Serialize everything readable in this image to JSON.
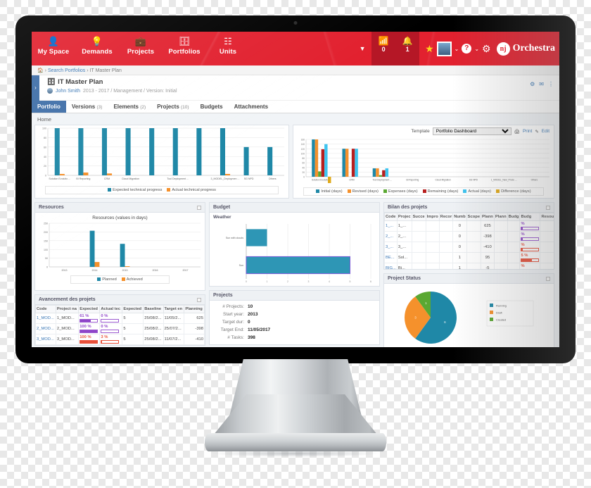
{
  "colors": {
    "brand_red": "#e2212f",
    "accent_blue": "#1f88a7",
    "orange": "#f5912c",
    "green": "#5aa832",
    "purple": "#8e44c8",
    "red": "#e8503a",
    "tab_blue": "#3f6fa8"
  },
  "topbar": {
    "nav": [
      {
        "label": "My Space",
        "icon": "user-icon"
      },
      {
        "label": "Demands",
        "icon": "lightbulb-icon"
      },
      {
        "label": "Projects",
        "icon": "briefcase-icon"
      },
      {
        "label": "Portfolios",
        "icon": "portfolio-icon"
      },
      {
        "label": "Units",
        "icon": "org-tree-icon"
      }
    ],
    "caret": "▼",
    "feed": {
      "icon": "rss-icon",
      "count": "0"
    },
    "alerts": {
      "icon": "bell-icon",
      "count": "1"
    },
    "star_icon": "star-icon",
    "avatar_caret": "⌄",
    "help_label": "?",
    "help_caret": "⌄",
    "gear_icon": "gear-icon",
    "brand": {
      "mark": "nj",
      "name": "Orchestra"
    }
  },
  "breadcrumb": {
    "home_icon": "home-icon",
    "sep1": "›",
    "link": "Search Portfolios",
    "sep2": "›",
    "current": "IT Master Plan"
  },
  "page": {
    "side_toggle": "›",
    "icon": "portfolio-icon",
    "title": "IT Master Plan",
    "owner": "John Smith",
    "meta": "2013 - 2017 / Management / Version: Initial",
    "actions": [
      "⚙",
      "✉",
      "⋮"
    ]
  },
  "tabs": [
    {
      "label": "Portfolio",
      "count": "",
      "active": true
    },
    {
      "label": "Versions",
      "count": "(3)",
      "active": false
    },
    {
      "label": "Elements",
      "count": "(2)",
      "active": false
    },
    {
      "label": "Projects",
      "count": "(10)",
      "active": false
    },
    {
      "label": "Budgets",
      "count": "",
      "active": false
    },
    {
      "label": "Attachments",
      "count": "",
      "active": false
    }
  ],
  "home_label": "Home",
  "template_bar": {
    "label": "Template",
    "selected": "Portfolio Dashboard",
    "options": [
      "Portfolio Dashboard"
    ],
    "print": "Print",
    "print_icon": "printer-icon",
    "edit": "Edit",
    "edit_icon": "pencil-icon"
  },
  "panels": {
    "resources": "Resources",
    "budget": "Budget",
    "bilan": "Bilan des projets",
    "project_status": "Project Status",
    "avancement": "Avancement des projets",
    "projects": "Projects",
    "weather": "Weather"
  },
  "projects_kv": [
    {
      "k": "# Projects:",
      "v": "10"
    },
    {
      "k": "Start year:",
      "v": "2013"
    },
    {
      "k": "Target dur:",
      "v": "0"
    },
    {
      "k": "Target End:",
      "v": "11/05/2017"
    },
    {
      "k": "# Tasks:",
      "v": "398"
    }
  ],
  "avancement": {
    "headers": [
      "Code",
      "Project na",
      "Expected",
      "Actual tec",
      "Expected",
      "Baseline",
      "Target en",
      "Planning"
    ],
    "rows": [
      {
        "code": "1_MOD...",
        "name": "1_MOD...",
        "exp": "61 %",
        "expv": 61,
        "act": "0 %",
        "actv": 0,
        "col": "purple",
        "e2": "5",
        "base": "25/08/2...",
        "tgt": "11/05/2...",
        "plan": "625"
      },
      {
        "code": "2_MOD...",
        "name": "2_MOD...",
        "exp": "100 %",
        "expv": 100,
        "act": "0 %",
        "actv": 0,
        "col": "purple",
        "e2": "5",
        "base": "25/08/2...",
        "tgt": "25/07/2...",
        "plan": "-398"
      },
      {
        "code": "3_MOD...",
        "name": "3_MOD...",
        "exp": "100 %",
        "expv": 100,
        "act": "3 %",
        "actv": 3,
        "col": "red",
        "e2": "5",
        "base": "25/08/2...",
        "tgt": "11/07/2...",
        "plan": "-410"
      }
    ]
  },
  "bilan": {
    "headers": [
      "Code",
      "Projec",
      "Succe",
      "Impro",
      "Recor",
      "Numb",
      "Scope",
      "Plann",
      "Plann",
      "Budg",
      "Budg",
      "Resou"
    ],
    "rows": [
      {
        "code": "1_...",
        "proj": "1_...",
        "numb": "0",
        "plann": "625",
        "pct": "%",
        "pctv": 8,
        "col": "purple"
      },
      {
        "code": "2_...",
        "proj": "2_...",
        "numb": "0",
        "plann": "-398",
        "pct": "%",
        "pctv": 6,
        "col": "purple"
      },
      {
        "code": "3_...",
        "proj": "3_...",
        "numb": "0",
        "plann": "-410",
        "pct": "%",
        "pctv": 7,
        "col": "red"
      },
      {
        "code": "BE...",
        "proj": "Sol...",
        "numb": "1",
        "plann": "95",
        "pct": "5 %",
        "pctv": 62,
        "col": "red"
      },
      {
        "code": "BIG...",
        "proj": "Bi...",
        "numb": "1",
        "plann": "-5",
        "pct": "%",
        "pctv": 40,
        "col": "red"
      }
    ]
  },
  "chart_data": [
    {
      "type": "bar",
      "name": "technical-progress-chart",
      "title": "",
      "categories": [
        "Solution Evolutio ...",
        "BI Reporting",
        "CRM",
        "Cloud Migration",
        "",
        "Tool Deployment ...",
        "",
        "3_MODEL_Deploymen ...",
        "SG NPD",
        "Others"
      ],
      "series": [
        {
          "name": "Expected technical progress",
          "color": "#1f88a7",
          "values": [
            100,
            100,
            100,
            100,
            100,
            100,
            100,
            100,
            60,
            60
          ]
        },
        {
          "name": "Actual technical progress",
          "color": "#f5912c",
          "values": [
            3,
            6,
            4,
            0,
            0,
            0,
            0,
            3,
            0,
            0
          ]
        }
      ],
      "ylim": [
        0,
        100
      ],
      "yticks": [
        0,
        20,
        40,
        60,
        80,
        100
      ],
      "ylabel": "",
      "xlabel": "",
      "grid": true,
      "legend": "bottom"
    },
    {
      "type": "bar",
      "name": "days-by-project-chart",
      "title": "",
      "categories": [
        "Solution Evolutio ...",
        "CRM",
        "Tool Deployment ...",
        "BI Reporting",
        "Cloud Migration",
        "SG NPD",
        "1_MODEL_New_Produ ...",
        "Others"
      ],
      "series": [
        {
          "name": "Initial (days)",
          "color": "#1f88a7",
          "values": [
            160,
            120,
            36,
            0,
            0,
            0,
            0,
            0
          ]
        },
        {
          "name": "Revised (days)",
          "color": "#f5912c",
          "values": [
            160,
            120,
            36,
            0,
            0,
            0,
            0,
            0
          ]
        },
        {
          "name": "Expenses (days)",
          "color": "#5aa832",
          "values": [
            23,
            0,
            7,
            0,
            0,
            0,
            0,
            0
          ]
        },
        {
          "name": "Remaining (days)",
          "color": "#b71f1f",
          "values": [
            118,
            120,
            28,
            0,
            0,
            0,
            0,
            0
          ]
        },
        {
          "name": "Actual (days)",
          "color": "#3fc4f0",
          "values": [
            140,
            120,
            36,
            0,
            0,
            0,
            0,
            0
          ]
        },
        {
          "name": "Difference (days)",
          "color": "#e0a91a",
          "values": [
            -14,
            0,
            0,
            0,
            0,
            0,
            0,
            0
          ]
        }
      ],
      "ylim": [
        0,
        160
      ],
      "yticks": [
        0,
        20,
        40,
        60,
        80,
        100,
        120,
        140,
        160
      ],
      "ylabel": "",
      "xlabel": "",
      "grid": true,
      "legend": "bottom"
    },
    {
      "type": "bar",
      "name": "resources-chart",
      "title": "Resources (values in days)",
      "categories": [
        "2013",
        "2014",
        "2015",
        "2016",
        "2017"
      ],
      "series": [
        {
          "name": "Planned",
          "color": "#1f88a7",
          "values": [
            0,
            207,
            132,
            0,
            0
          ]
        },
        {
          "name": "Achieved",
          "color": "#f5912c",
          "values": [
            0,
            28,
            4,
            0,
            0
          ]
        }
      ],
      "ylim": [
        0,
        250
      ],
      "yticks": [
        0,
        50,
        100,
        150,
        200,
        250
      ],
      "ylabel": "",
      "xlabel": "",
      "grid": true,
      "legend": "bottom"
    },
    {
      "type": "bar",
      "name": "weather-chart",
      "orientation": "horizontal",
      "title": "",
      "categories": [
        "Sun with clouds",
        "Sun"
      ],
      "values": [
        1,
        5
      ],
      "color": "#2e96b5",
      "highlight_index": 1,
      "xlim": [
        0,
        6
      ],
      "xticks": [
        0,
        1,
        2,
        3,
        4,
        5,
        6
      ],
      "grid": true,
      "legend": "none"
    },
    {
      "type": "pie",
      "name": "project-status-pie",
      "title": "",
      "labels": [
        "Running",
        "Draft",
        "Created"
      ],
      "values": [
        6,
        3,
        1
      ],
      "colors": [
        "#1f88a7",
        "#f5912c",
        "#5aa832"
      ],
      "legend": "right"
    }
  ]
}
